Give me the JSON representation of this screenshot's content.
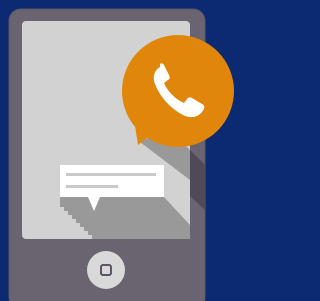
{
  "illustration": {
    "device": "smartphone",
    "icons": {
      "call": "phone-handset-icon",
      "message": "chat-bubble-icon",
      "home": "home-button-icon"
    },
    "colors": {
      "background": "#0b2a72",
      "phone_body": "#6a6470",
      "phone_body_edge": "#56515c",
      "screen": "#d3d2d2",
      "screen_shadow": "#9a9999",
      "call_bubble": "#e0860a",
      "call_icon": "#ffffff",
      "message_bubble": "#ffffff",
      "message_lines": "#c9c9c9",
      "home_button": "#d9d9d9"
    }
  }
}
